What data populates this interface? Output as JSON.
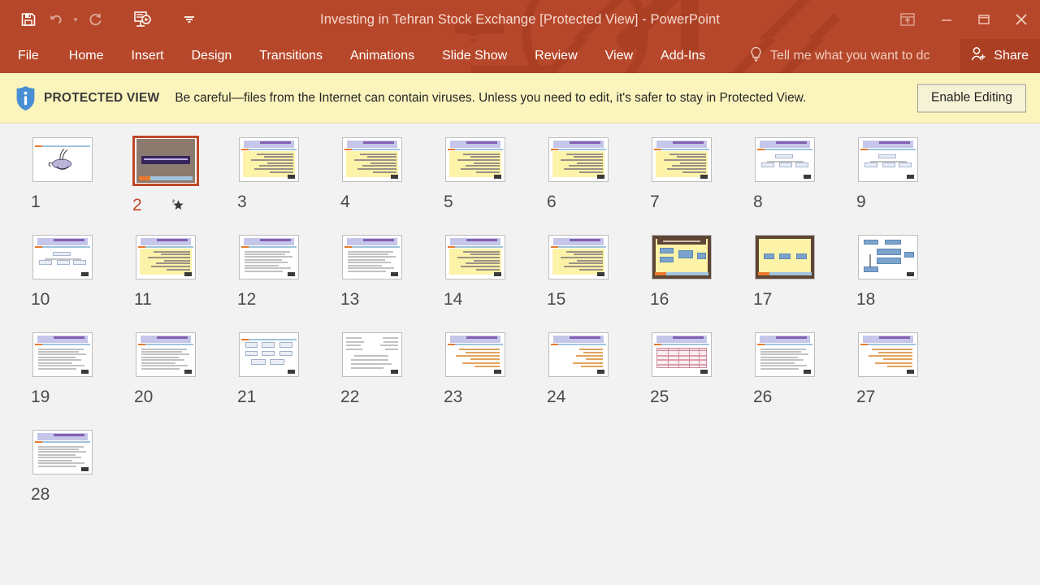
{
  "window": {
    "title": "Investing in Tehran Stock Exchange [Protected View] - PowerPoint",
    "accent_color": "#b7472a",
    "quick_access": [
      {
        "name": "save",
        "label": "Save",
        "state": "enabled"
      },
      {
        "name": "undo",
        "label": "Undo",
        "state": "disabled"
      },
      {
        "name": "undo-dropdown",
        "label": "Undo options",
        "state": "disabled"
      },
      {
        "name": "redo",
        "label": "Redo",
        "state": "disabled"
      },
      {
        "name": "start-from-beginning",
        "label": "Start From Beginning",
        "state": "enabled"
      },
      {
        "name": "customize-qat",
        "label": "Customize Quick Access Toolbar",
        "state": "enabled"
      }
    ],
    "controls": [
      {
        "name": "ribbon-display-options",
        "label": "Ribbon Display Options"
      },
      {
        "name": "minimize",
        "label": "Minimize"
      },
      {
        "name": "restore",
        "label": "Restore Down"
      },
      {
        "name": "close",
        "label": "Close"
      }
    ]
  },
  "ribbon": {
    "tabs": [
      {
        "label": "File",
        "active": false
      },
      {
        "label": "Home",
        "active": false
      },
      {
        "label": "Insert",
        "active": false
      },
      {
        "label": "Design",
        "active": false
      },
      {
        "label": "Transitions",
        "active": false
      },
      {
        "label": "Animations",
        "active": false
      },
      {
        "label": "Slide Show",
        "active": false
      },
      {
        "label": "Review",
        "active": false
      },
      {
        "label": "View",
        "active": false
      },
      {
        "label": "Add-Ins",
        "active": false
      }
    ],
    "tell_me_placeholder": "Tell me what you want to dc",
    "share_label": "Share"
  },
  "protected_view": {
    "badge": "PROTECTED VIEW",
    "message": "Be careful—files from the Internet can contain viruses. Unless you need to edit, it's safer to stay in Protected View.",
    "button_label": "Enable Editing",
    "bar_color": "#fbf4bd"
  },
  "slide_sorter": {
    "selected_slide": 2,
    "slides": [
      {
        "number": "1",
        "style": "logo",
        "animated": false
      },
      {
        "number": "2",
        "style": "dark-title",
        "animated": true
      },
      {
        "number": "3",
        "style": "yellow",
        "animated": false
      },
      {
        "number": "4",
        "style": "yellow",
        "animated": false
      },
      {
        "number": "5",
        "style": "yellow",
        "animated": false
      },
      {
        "number": "6",
        "style": "yellow",
        "animated": false
      },
      {
        "number": "7",
        "style": "yellow",
        "animated": false
      },
      {
        "number": "8",
        "style": "diagram",
        "animated": false
      },
      {
        "number": "9",
        "style": "diagram",
        "animated": false
      },
      {
        "number": "10",
        "style": "diagram",
        "animated": false
      },
      {
        "number": "11",
        "style": "yellow",
        "animated": false
      },
      {
        "number": "12",
        "style": "text",
        "animated": false
      },
      {
        "number": "13",
        "style": "text",
        "animated": false
      },
      {
        "number": "14",
        "style": "yellow",
        "animated": false
      },
      {
        "number": "15",
        "style": "yellow",
        "animated": false
      },
      {
        "number": "16",
        "style": "framed-diagram",
        "animated": false
      },
      {
        "number": "17",
        "style": "framed-diagram-2",
        "animated": false
      },
      {
        "number": "18",
        "style": "flowchart",
        "animated": false
      },
      {
        "number": "19",
        "style": "text",
        "animated": false
      },
      {
        "number": "20",
        "style": "text",
        "animated": false
      },
      {
        "number": "21",
        "style": "flowchart-2",
        "animated": false
      },
      {
        "number": "22",
        "style": "plain-diagram",
        "animated": false
      },
      {
        "number": "23",
        "style": "text-orange",
        "animated": false
      },
      {
        "number": "24",
        "style": "text-orange-2",
        "animated": false
      },
      {
        "number": "25",
        "style": "table",
        "animated": false
      },
      {
        "number": "26",
        "style": "text",
        "animated": false
      },
      {
        "number": "27",
        "style": "text-orange",
        "animated": false
      },
      {
        "number": "28",
        "style": "text",
        "animated": false
      }
    ]
  }
}
